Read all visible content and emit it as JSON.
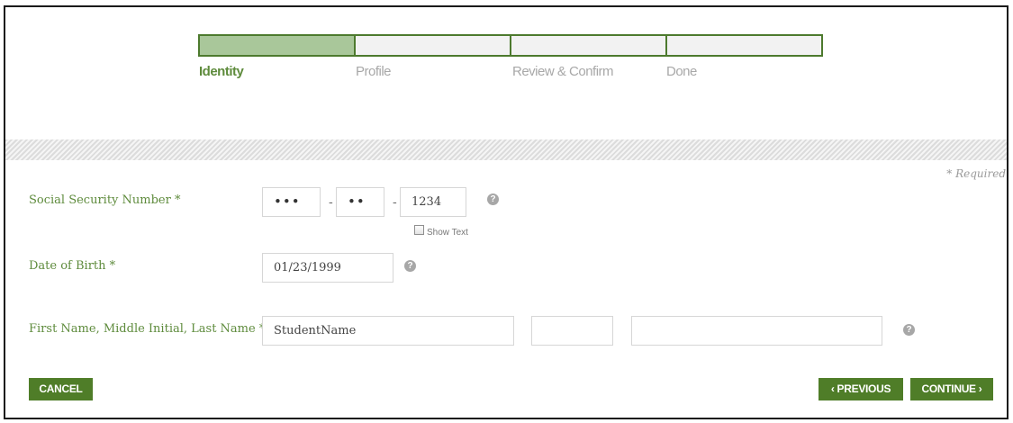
{
  "steps": [
    {
      "label": "Identity",
      "active": true
    },
    {
      "label": "Profile",
      "active": false
    },
    {
      "label": "Review & Confirm",
      "active": false
    },
    {
      "label": "Done",
      "active": false
    }
  ],
  "required_note": "* Required",
  "ssn": {
    "label": "Social Security Number *",
    "part1": "•••",
    "part2": "••",
    "part3": "1234",
    "separator": "-",
    "show_text_label": "Show Text",
    "show_text_checked": false
  },
  "dob": {
    "label": "Date of Birth *",
    "value": "01/23/1999"
  },
  "name": {
    "label": "First Name, Middle Initial, Last Name *",
    "first": "StudentName",
    "middle": "",
    "last": ""
  },
  "help_glyph": "?",
  "buttons": {
    "cancel": "CANCEL",
    "previous": "‹ PREVIOUS",
    "continue": "CONTINUE ›"
  },
  "colors": {
    "accent": "#5e8b3c",
    "button": "#4f7d28",
    "step_active": "#a9c79a"
  }
}
